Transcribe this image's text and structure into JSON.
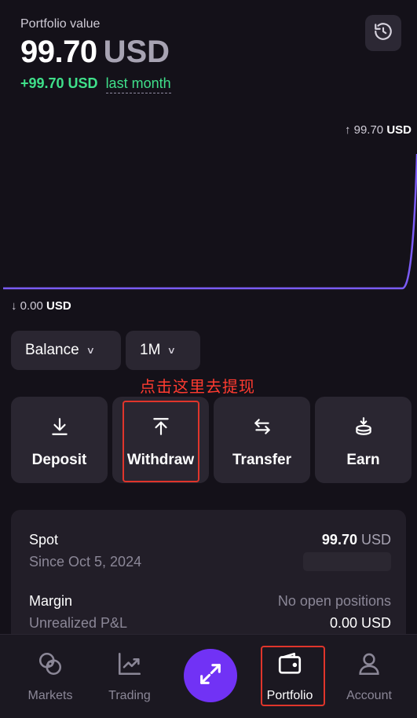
{
  "header": {
    "label": "Portfolio value",
    "value": "99.70",
    "currency": "USD",
    "change": "+99.70 USD",
    "period": "last month"
  },
  "chart_data": {
    "type": "line",
    "high_label": "99.70",
    "high_currency": "USD",
    "low_label": "0.00",
    "low_currency": "USD",
    "values": [
      0,
      0,
      0,
      0,
      0,
      0,
      0,
      0,
      0,
      0,
      0,
      0,
      0,
      0,
      0,
      0,
      0,
      0,
      0,
      0,
      0,
      0,
      0,
      0,
      0,
      0,
      0,
      0,
      99.7
    ],
    "ylim": [
      0,
      99.7
    ],
    "line_color": "#7b5cf5"
  },
  "filters": {
    "balance_label": "Balance",
    "range_label": "1M"
  },
  "annotation": "点击这里去提现",
  "actions": [
    {
      "label": "Deposit",
      "icon": "download-icon"
    },
    {
      "label": "Withdraw",
      "icon": "upload-icon"
    },
    {
      "label": "Transfer",
      "icon": "transfer-icon"
    },
    {
      "label": "Earn",
      "icon": "earn-icon"
    }
  ],
  "accounts": {
    "spot": {
      "title": "Spot",
      "subtitle": "Since Oct 5, 2024",
      "value": "99.70",
      "currency": "USD"
    },
    "margin": {
      "title": "Margin",
      "subtitle": "Unrealized P&L",
      "status": "No open positions",
      "value": "0.00 USD"
    }
  },
  "nav": [
    {
      "label": "Markets",
      "icon": "markets-icon"
    },
    {
      "label": "Trading",
      "icon": "trading-icon"
    },
    {
      "label": "Portfolio",
      "icon": "wallet-icon"
    },
    {
      "label": "Account",
      "icon": "account-icon"
    }
  ],
  "colors": {
    "accent": "#7132f5",
    "positive": "#3fe08a",
    "annotation": "#ff3b30"
  }
}
